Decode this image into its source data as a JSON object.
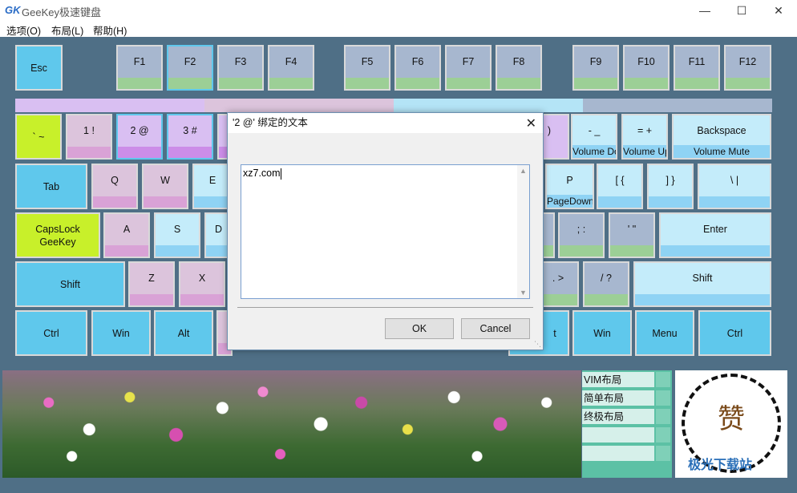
{
  "window": {
    "title": "GeeKey极速键盘",
    "icon": "geekey-logo-icon"
  },
  "menu": [
    "选项(O)",
    "布局(L)",
    "帮助(H)"
  ],
  "keys": {
    "esc": "Esc",
    "f1": "F1",
    "f2": "F2",
    "f3": "F3",
    "f4": "F4",
    "f5": "F5",
    "f6": "F6",
    "f7": "F7",
    "f8": "F8",
    "f9": "F9",
    "f10": "F10",
    "f11": "F11",
    "f12": "F12",
    "backtick": "` ~",
    "one": "1 !",
    "two": "2 @",
    "three": "3 #",
    "paren": ")",
    "minus": "- _",
    "minus_sub": "Volume Down",
    "equals": "= +",
    "equals_sub": "Volume Up",
    "backspace": "Backspace",
    "backspace_sub": "Volume Mute",
    "tab": "Tab",
    "q": "Q",
    "w": "W",
    "e": "E",
    "p": "P",
    "p_sub": "PageDown",
    "lbracket": "[ {",
    "rbracket": "] }",
    "backslash": "\\ |",
    "capslock": "CapsLock\nGeeKey",
    "a": "A",
    "s": "S",
    "d": "D",
    "semicolon": "; :",
    "quote": "' \"",
    "enter": "Enter",
    "lshift": "Shift",
    "z": "Z",
    "x": "X",
    "period": ". >",
    "slash": "/ ?",
    "rshift": "Shift",
    "lctrl": "Ctrl",
    "lwin": "Win",
    "lalt": "Alt",
    "ralt": "t",
    "rwin": "Win",
    "menu": "Menu",
    "rctrl": "Ctrl"
  },
  "colors": {
    "key_blue": "#5fc8ec",
    "key_light_blue": "#c4ecfa",
    "key_gray": "#a7b7cf",
    "key_lime": "#c8f02a",
    "key_pink": "#dcc4dc",
    "key_purple_hl": "#d9bff2",
    "bar_green": "#9ccf96",
    "bar_pink": "#d9a2d6",
    "bar_purple": "#cc8de8",
    "bar_blue": "#8fd3f4"
  },
  "layouts": [
    "VIM布局",
    "简单布局",
    "终极布局"
  ],
  "qr": {
    "center_text": "赞"
  },
  "watermark": "极光下载站",
  "dialog": {
    "title": "'2  @' 绑定的文本",
    "text_value": "xz7.com",
    "ok_label": "OK",
    "cancel_label": "Cancel"
  }
}
